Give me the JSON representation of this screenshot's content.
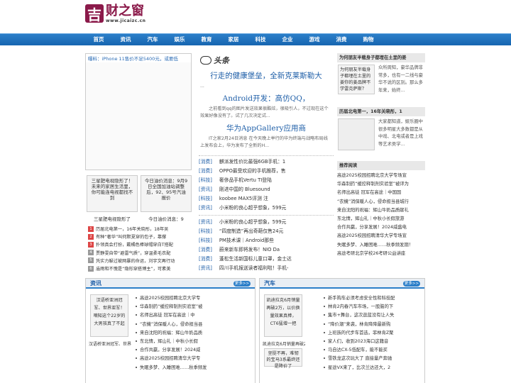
{
  "logo": {
    "mark": "吉",
    "name": "财之窗",
    "url": "www.jicaizc.cn"
  },
  "nav": [
    "首页",
    "资讯",
    "汽车",
    "娱乐",
    "教育",
    "家居",
    "科技",
    "企业",
    "游戏",
    "消费",
    "购物"
  ],
  "ad": {
    "title": "曝料：iPhone 11售价不足5400元，或要低"
  },
  "thumbs": [
    {
      "alt": "三星肥电视隐形了！未来的家居生活里，你可能连电视都找不到",
      "caption": "三星肥电视隐形了"
    },
    {
      "alt": "今日油价消息：9月9日全国加油站调整后，92、95号汽油报价",
      "caption": "今日油价消息：9"
    }
  ],
  "hotlist": [
    {
      "num": "1",
      "color": "#d44",
      "text": "历届北电第一，16年关晓彤，18年吴"
    },
    {
      "num": "2",
      "color": "#d44",
      "text": "有种“奢华”叫何默夏穿的包子，靠撑"
    },
    {
      "num": "3",
      "color": "#d44",
      "text": "扑领真会打扮，戴橘色棒球帽穿白T搭配"
    },
    {
      "num": "4",
      "color": "#999",
      "text": "贾静雯自带“避雷气质”，穿温柔毛衣配"
    },
    {
      "num": "5",
      "color": "#999",
      "text": "凭实力躲过被网暴的命运，刘宇文再行动"
    },
    {
      "num": "6",
      "color": "#999",
      "text": "庙雨和不愧是“隐形穿搭博主”，可素美"
    }
  ],
  "toutiao": "头条",
  "headlines": [
    {
      "title": "行走的健康堡垒，全新克莱斯勒大",
      "desc": "..."
    },
    {
      "title": "Android开发：高仿QQ，",
      "desc": "之前看到qq的图片发送效果很酷炫，很吸引人，不过现在这个效果好像没有了。试了几次决定试..."
    },
    {
      "title": "华为AppGallery应用商",
      "desc": "IT之家2月24日消息 在今天晚上举行的华为终端与战略布局线上发布会上，华为发布了全新的H..."
    }
  ],
  "news1": [
    {
      "cat": "[消费]",
      "title": "麒派发性价比最强6GB手机：1"
    },
    {
      "cat": "[消费]",
      "title": "OPPO最受欢迎的手机推荐，售"
    },
    {
      "cat": "[科技]",
      "title": "奢侈品手机Vertu TI登陆"
    },
    {
      "cat": "[资讯]",
      "title": "刚进中国的 Bluesound"
    },
    {
      "cat": "[科技]",
      "title": "koobee MAX5评测 注"
    },
    {
      "cat": "[资讯]",
      "title": "小米粉的良心超乎想象，599元"
    }
  ],
  "news2": [
    {
      "cat": "[资讯]",
      "title": "小米粉的良心超乎想象，599元"
    },
    {
      "cat": "[科技]",
      "title": "“四度制造”再出奇葩仅售24元"
    },
    {
      "cat": "[科技]",
      "title": "PM技术课｜Android那些"
    },
    {
      "cat": "[消费]",
      "title": "蔚来新车即将发布！NIO Da"
    },
    {
      "cat": "[消费]",
      "title": "蓬松生活新国标儿童口罩，金士达"
    },
    {
      "cat": "[资讯]",
      "title": "四川手机报送读者福利啦！手机-"
    }
  ],
  "right": {
    "box1": {
      "title": "为何朋友半载身子都埋在土里的姜",
      "img": "为何朋友半载身子都埋在土里的姜你的姜品牌不学雷克萨斯？",
      "text": "众所周知，豪华品牌非常多，也有一二线与豪华不说的区别。那么多年来，始终..."
    },
    "box2": {
      "title": "历届北电第一，16年关晓彤，1",
      "text": "大家都知道，娱乐圈中很多明星大多数都是从中戏、北电或者是上戏等艺术类学..."
    },
    "rec_title": "推荐阅读",
    "rec": [
      "高途2025校园招聘北京大学专场宣",
      "华森制药“缓控释制剂实验室”被评为",
      "名师出高徒 冠军在高途｜中国国",
      "“农機”消保暖人心，侵命担当县城行",
      "来自沈阳的祝福：辉山牛奶品质献礼",
      "东北情，辉山礼｜中秋小长假旅游",
      "合作共赢，分享发展！2024威盛电",
      "高途2025校园招聘清华大学专场宣",
      "失眠多梦、入睡困难……秋季频发期！",
      "高途考研北京学校26考研公益讲座"
    ]
  },
  "section_zixun": {
    "title": "资讯",
    "more": "更多>>",
    "img": "汉语桥亚洲冠军、世界亚军！嘀知这个22岁的大男孩真了不起",
    "caption": "汉语桥亚洲冠军、世界亚",
    "list": [
      "高途2025校园招聘北京大学专",
      "华森制药“缓控释制剂实验室”被",
      "名师出高徒 冠军在高途｜中",
      "“农機”消保暖人心，侵命担当县",
      "来自沈阳的祝福：辉山牛奶品质",
      "东北情，辉山礼｜中秋小长假",
      "合作共赢，分享发展！2024威",
      "高途2025校园招聘清华大学专",
      "失眠多梦、入睡困难……秋季频发"
    ]
  },
  "section_qiche": {
    "title": "汽车",
    "more": "更多>>",
    "img": "凯迪拉克6月销量再破2万，以价换量效果真棒，CT6猛增一把",
    "caption": "凯迪拉克6月销量再破2万，",
    "img2": "坚挺不再，难韧的宝马3系最终还是降价了",
    "list": [
      "新手购车必须考虑安全性和科技配",
      "林肯2内春汽车市场，一股脑的下",
      "集市+舞台，这次逛蓝没有让人失",
      "“降价潮”来袭，林肯降降最新购",
      "上班族的代步车首选，菲林肯Z聚",
      "家人们，收到2023海口这籍音",
      "马自达CX-5低配车，能不能买",
      "雪铁龙这次玩大了 直接量产奔驰",
      "星途VX来了，比次兰达还大，2"
    ]
  }
}
